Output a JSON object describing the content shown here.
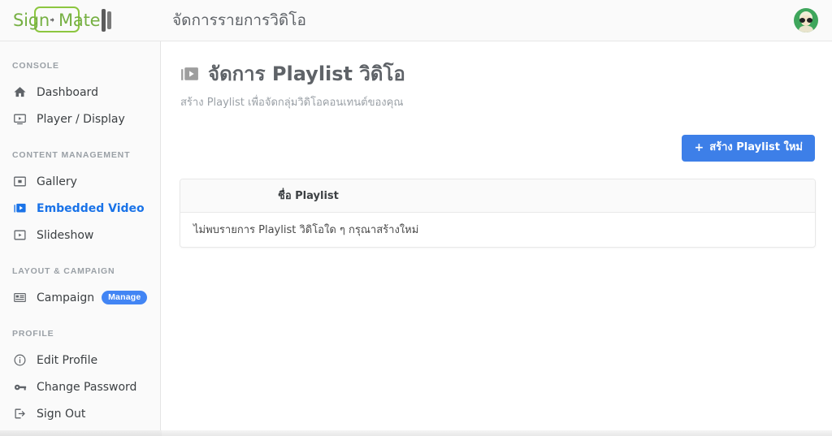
{
  "brand": {
    "logo_text_left": "Sign",
    "logo_text_right": "Mate",
    "logo_icon": "arrow-play-dot"
  },
  "topbar": {
    "title": "จัดการรายการวิดิโอ",
    "avatar_icon": "user-avatar"
  },
  "sidebar": {
    "groups": [
      {
        "title": "CONSOLE",
        "items": [
          {
            "label": "Dashboard",
            "icon": "home-icon",
            "active": false
          },
          {
            "label": "Player / Display",
            "icon": "player-display-icon",
            "active": false
          }
        ]
      },
      {
        "title": "CONTENT MANAGEMENT",
        "items": [
          {
            "label": "Gallery",
            "icon": "gallery-icon",
            "active": false
          },
          {
            "label": "Embedded Video",
            "icon": "video-library-icon",
            "active": true
          },
          {
            "label": "Slideshow",
            "icon": "slideshow-icon",
            "active": false
          }
        ]
      },
      {
        "title": "LAYOUT & CAMPAIGN",
        "items": [
          {
            "label": "Campaign",
            "icon": "campaign-list-icon",
            "active": false,
            "badge": "Manage"
          }
        ]
      },
      {
        "title": "PROFILE",
        "items": [
          {
            "label": "Edit Profile",
            "icon": "info-circle-icon",
            "active": false
          },
          {
            "label": "Change Password",
            "icon": "key-icon",
            "active": false
          },
          {
            "label": "Sign Out",
            "icon": "sign-out-icon",
            "active": false
          }
        ]
      }
    ]
  },
  "main": {
    "page_icon": "video-library-icon",
    "page_title": "จัดการ Playlist วิดิโอ",
    "page_subtitle": "สร้าง Playlist เพื่อจัดกลุ่มวิดิโอคอนเทนต์ของคุณ",
    "create_button": {
      "plus": "+",
      "label": "สร้าง Playlist ใหม่"
    },
    "table": {
      "columns": [
        "ชื่อ Playlist"
      ],
      "rows": [],
      "empty_message": "ไม่พบรายการ Playlist วิดิโอใด ๆ กรุณาสร้างใหม่"
    }
  },
  "colors": {
    "accent_blue": "#3d7fe8",
    "active_blue": "#1a73e8",
    "brand_green": "#76b043",
    "avatar_green": "#3fa65c",
    "sidebar_bg": "#fafafa",
    "text_primary": "#3c4043",
    "text_muted": "#9aa0a6"
  }
}
